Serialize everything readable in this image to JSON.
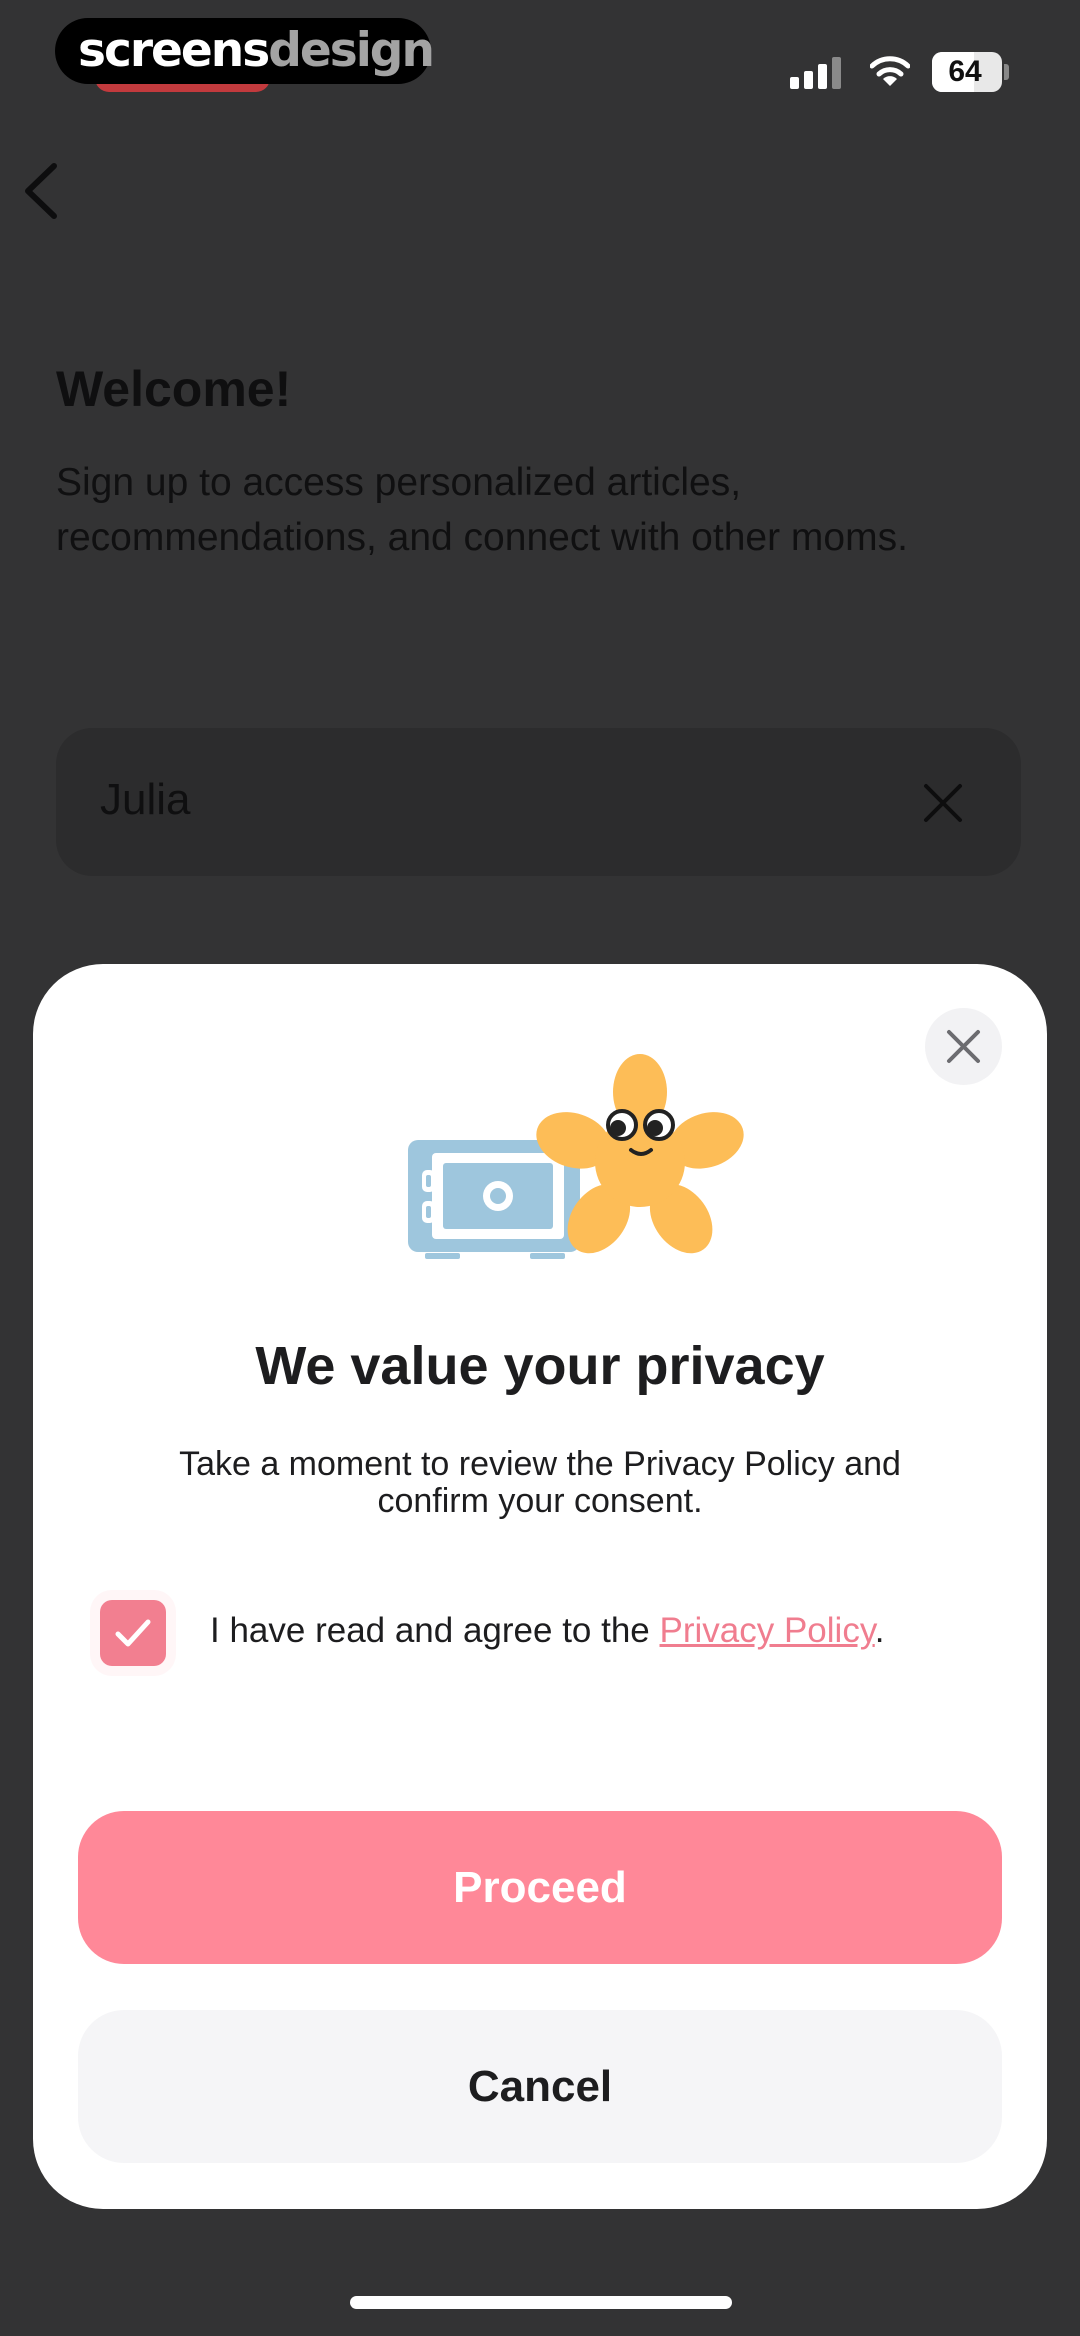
{
  "watermark": {
    "part1": "screens",
    "part2": "design"
  },
  "status_bar": {
    "battery": "64"
  },
  "background_screen": {
    "title": "Welcome!",
    "subtitle": "Sign up to access personalized articles, recommendations, and connect with other moms.",
    "name_field_value": "Julia"
  },
  "modal": {
    "title": "We value your privacy",
    "body": "Take a moment to review the Privacy Policy and confirm your consent.",
    "consent_prefix": "I have read and agree to the ",
    "consent_link": "Privacy Policy",
    "consent_suffix": ".",
    "consent_checked": true,
    "proceed_label": "Proceed",
    "cancel_label": "Cancel"
  },
  "colors": {
    "accent": "#ff8898",
    "link": "#f07d8f",
    "overlay": "#333334",
    "safe_icon": "#9ec6dd",
    "flower": "#fdbd57"
  },
  "icons": [
    "back-chevron-icon",
    "clear-x-icon",
    "close-icon",
    "safe-icon",
    "flower-mascot-icon",
    "checkmark-icon",
    "wifi-icon",
    "signal-icon",
    "battery-icon"
  ]
}
